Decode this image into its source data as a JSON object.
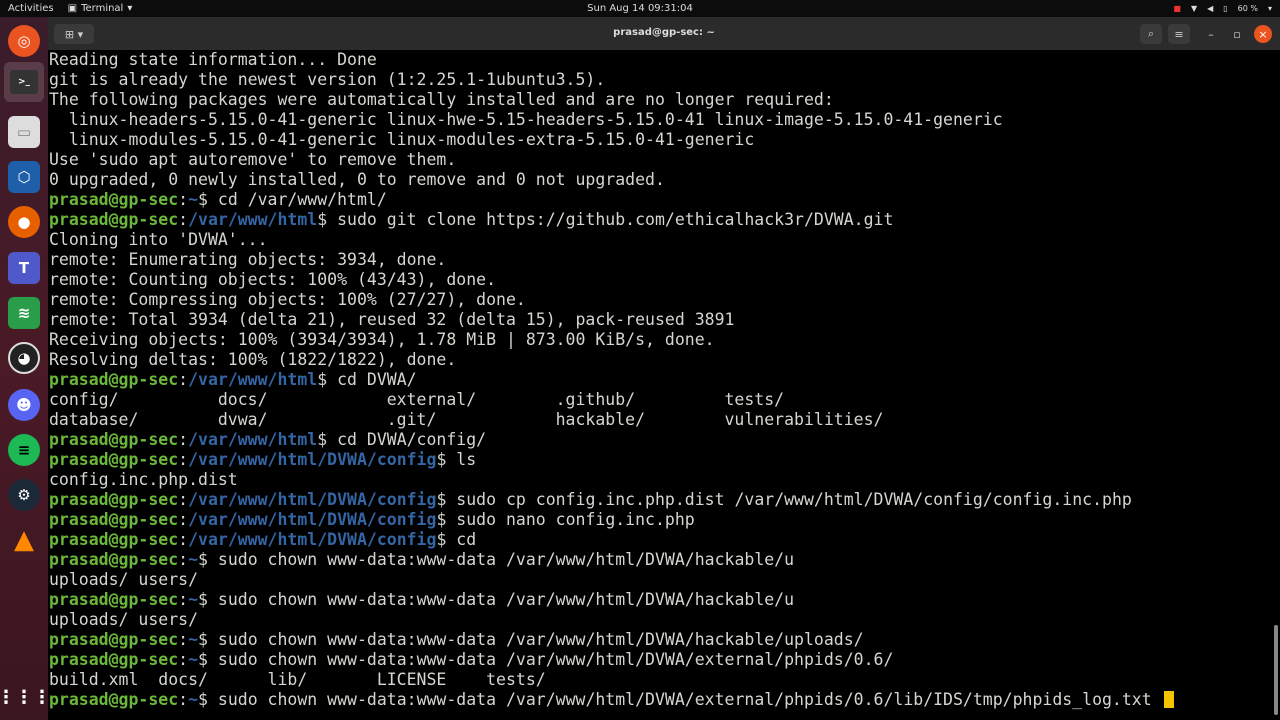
{
  "topbar": {
    "activities": "Activities",
    "app": "Terminal",
    "clock": "Sun Aug 14  09:31:04",
    "battery": "60 %"
  },
  "window": {
    "title": "prasad@gp-sec: ~"
  },
  "dock": [
    "ubuntu-icon",
    "terminal-icon",
    "files-icon",
    "virtualbox-icon",
    "firefox-icon",
    "teams-icon",
    "layers-icon",
    "obs-icon",
    "discord-icon",
    "spotify-icon",
    "steam-icon",
    "vlc-icon",
    "app-grid-icon"
  ],
  "terminal": {
    "host": "prasad@gp-sec",
    "lines": [
      {
        "t": "Reading state information... Done"
      },
      {
        "t": "git is already the newest version (1:2.25.1-1ubuntu3.5)."
      },
      {
        "t": "The following packages were automatically installed and are no longer required:"
      },
      {
        "t": "  linux-headers-5.15.0-41-generic linux-hwe-5.15-headers-5.15.0-41 linux-image-5.15.0-41-generic"
      },
      {
        "t": "  linux-modules-5.15.0-41-generic linux-modules-extra-5.15.0-41-generic"
      },
      {
        "t": "Use 'sudo apt autoremove' to remove them."
      },
      {
        "t": "0 upgraded, 0 newly installed, 0 to remove and 0 not upgraded."
      },
      {
        "p": "~",
        "c": " cd /var/www/html/"
      },
      {
        "p": "/var/www/html",
        "c": " sudo git clone https://github.com/ethicalhack3r/DVWA.git"
      },
      {
        "t": "Cloning into 'DVWA'..."
      },
      {
        "t": "remote: Enumerating objects: 3934, done."
      },
      {
        "t": "remote: Counting objects: 100% (43/43), done."
      },
      {
        "t": "remote: Compressing objects: 100% (27/27), done."
      },
      {
        "t": "remote: Total 3934 (delta 21), reused 32 (delta 15), pack-reused 3891"
      },
      {
        "t": "Receiving objects: 100% (3934/3934), 1.78 MiB | 873.00 KiB/s, done."
      },
      {
        "t": "Resolving deltas: 100% (1822/1822), done."
      },
      {
        "p": "/var/www/html",
        "c": " cd DVWA/"
      },
      {
        "t": "config/          docs/            external/        .github/         tests/"
      },
      {
        "t": "database/        dvwa/            .git/            hackable/        vulnerabilities/"
      },
      {
        "p": "/var/www/html",
        "c": " cd DVWA/config/"
      },
      {
        "p": "/var/www/html/DVWA/config",
        "c": " ls"
      },
      {
        "t": "config.inc.php.dist"
      },
      {
        "p": "/var/www/html/DVWA/config",
        "c": " sudo cp config.inc.php.dist /var/www/html/DVWA/config/config.inc.php"
      },
      {
        "p": "/var/www/html/DVWA/config",
        "c": " sudo nano config.inc.php"
      },
      {
        "p": "/var/www/html/DVWA/config",
        "c": " cd"
      },
      {
        "p": "~",
        "c": " sudo chown www-data:www-data /var/www/html/DVWA/hackable/u"
      },
      {
        "t": "uploads/ users/"
      },
      {
        "p": "~",
        "c": " sudo chown www-data:www-data /var/www/html/DVWA/hackable/u"
      },
      {
        "t": "uploads/ users/"
      },
      {
        "p": "~",
        "c": " sudo chown www-data:www-data /var/www/html/DVWA/hackable/uploads/"
      },
      {
        "p": "~",
        "c": " sudo chown www-data:www-data /var/www/html/DVWA/external/phpids/0.6/"
      },
      {
        "t": "build.xml  docs/      lib/       LICENSE    tests/"
      },
      {
        "p": "~",
        "c": " sudo chown www-data:www-data /var/www/html/DVWA/external/phpids/0.6/lib/IDS/tmp/phpids_log.txt ",
        "cursor": true
      }
    ]
  }
}
